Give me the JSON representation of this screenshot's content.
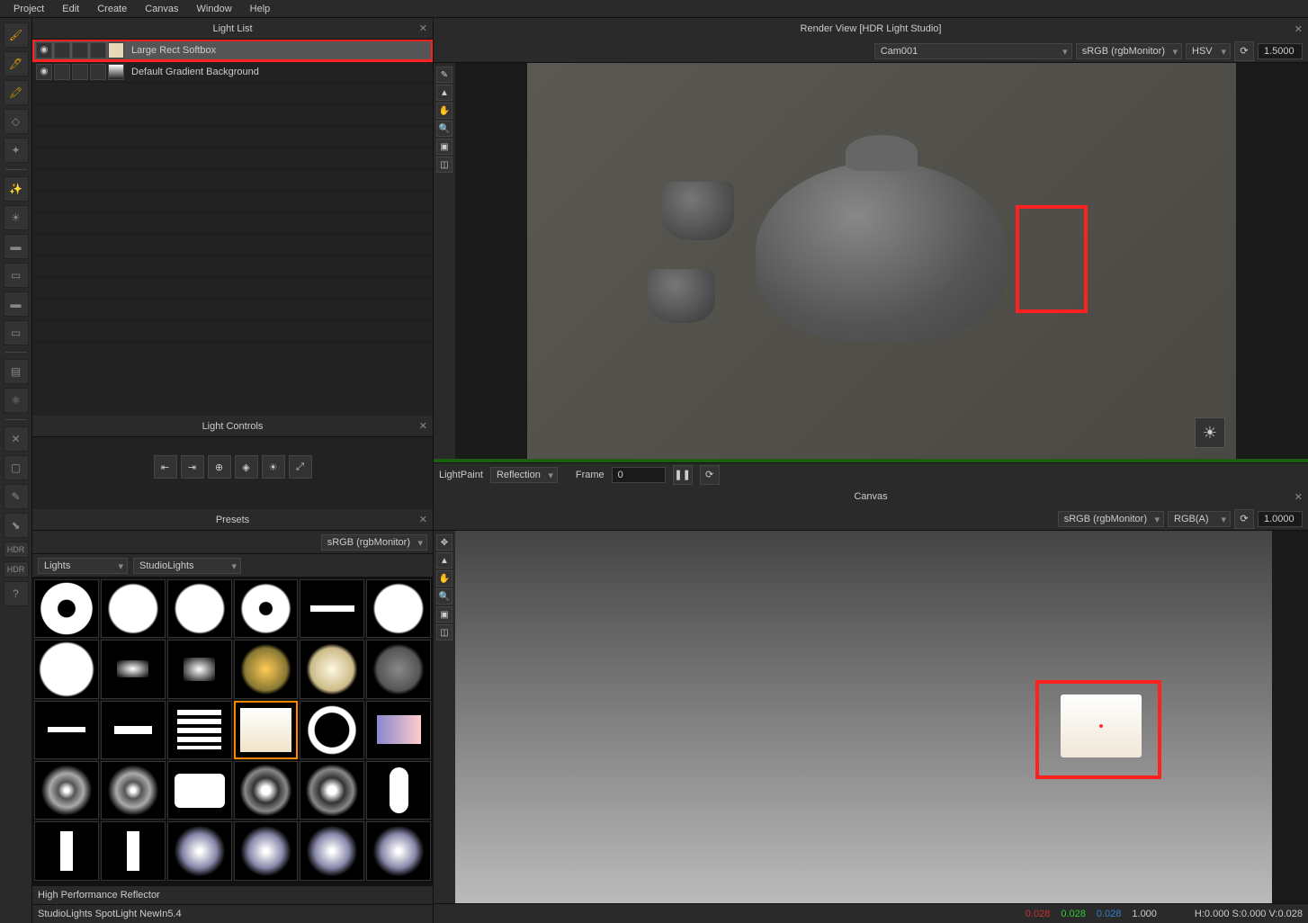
{
  "menu": {
    "items": [
      "Project",
      "Edit",
      "Create",
      "Canvas",
      "Window",
      "Help"
    ]
  },
  "lightList": {
    "title": "Light List",
    "items": [
      {
        "name": "Large Rect Softbox",
        "swatch": "#e8d8b8"
      },
      {
        "name": "Default Gradient Background",
        "swatch": "linear-gradient(#fff,#222)"
      }
    ]
  },
  "lightControls": {
    "title": "Light Controls"
  },
  "presets": {
    "title": "Presets",
    "colorspace": "sRGB (rgbMonitor)",
    "category1": "Lights",
    "category2": "StudioLights",
    "footer1": "High Performance Reflector",
    "footer2": "StudioLights SpotLight NewIn5.4"
  },
  "renderView": {
    "title": "Render View [HDR Light Studio]",
    "camera": "Cam001",
    "colorspace": "sRGB (rgbMonitor)",
    "colormode": "HSV",
    "exposure": "1.5000",
    "lightpaint_label": "LightPaint",
    "lightpaint_mode": "Reflection",
    "frame_label": "Frame",
    "frame": "0"
  },
  "canvas": {
    "title": "Canvas",
    "colorspace": "sRGB (rgbMonitor)",
    "channel": "RGB(A)",
    "exposure": "1.0000",
    "readout_r": "0.028",
    "readout_g": "0.028",
    "readout_b": "0.028",
    "readout_a": "1.000",
    "readout_hsv": "H:0.000 S:0.000 V:0.028"
  },
  "toolbarIcons": [
    "🖌",
    "🖊",
    "🖍",
    "◇",
    "✦",
    "",
    "🔆",
    "💡",
    "▭",
    "▭",
    "▭",
    "▭",
    "",
    "▤",
    "⚛",
    "",
    "✕",
    "▢",
    "✎",
    "⬊",
    "HDR",
    "HDR",
    "?"
  ]
}
